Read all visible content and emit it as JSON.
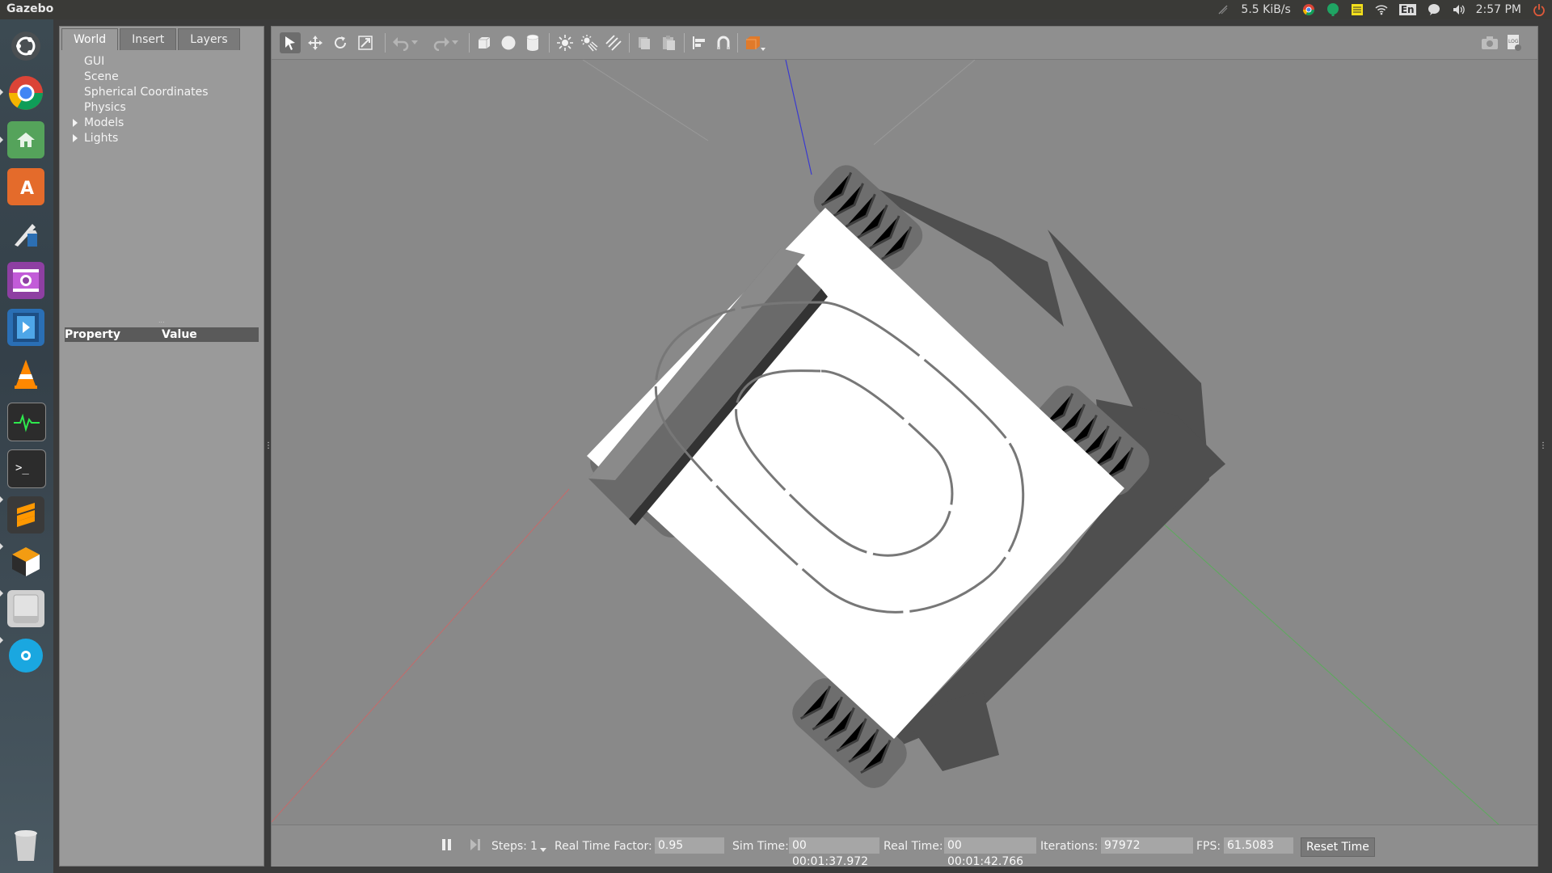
{
  "topbar": {
    "app_title": "Gazebo",
    "network_speed": "5.5 KiB/s",
    "keyboard_layout": "En",
    "time": "2:57 PM",
    "icons": [
      "wireless-icon",
      "chrome-tray-icon",
      "notification-icon",
      "sticky-notes-icon",
      "wifi-icon",
      "keyboard-icon",
      "messaging-icon",
      "volume-icon",
      "power-icon"
    ]
  },
  "launcher": {
    "items": [
      {
        "name": "ubuntu-dash-icon",
        "bg": "#4a4f52"
      },
      {
        "name": "chrome-icon",
        "bg": "#39444b"
      },
      {
        "name": "files-icon",
        "bg": "#55a35b"
      },
      {
        "name": "software-center-icon",
        "bg": "#e46b2b"
      },
      {
        "name": "editor-icon",
        "bg": "#39444b"
      },
      {
        "name": "screen-recorder-icon",
        "bg": "#8e3fa2"
      },
      {
        "name": "video-player-icon",
        "bg": "#2a6fb5"
      },
      {
        "name": "vlc-icon",
        "bg": "#39444b"
      },
      {
        "name": "system-monitor-icon",
        "bg": "#2c2c2c"
      },
      {
        "name": "terminal-icon",
        "bg": "#2c2c2c"
      },
      {
        "name": "sublime-text-icon",
        "bg": "#3a3a3a"
      },
      {
        "name": "gazebo-icon",
        "bg": "#3a3a3a"
      },
      {
        "name": "drive-icon",
        "bg": "#d0d0d0"
      },
      {
        "name": "disc-icon",
        "bg": "#1aa7e0"
      },
      {
        "name": "trash-icon",
        "bg": "#39444b"
      }
    ]
  },
  "left_panel": {
    "tabs": [
      "World",
      "Insert",
      "Layers"
    ],
    "active_tab": "World",
    "tree": [
      {
        "label": "GUI",
        "expandable": false
      },
      {
        "label": "Scene",
        "expandable": false
      },
      {
        "label": "Spherical Coordinates",
        "expandable": false
      },
      {
        "label": "Physics",
        "expandable": false
      },
      {
        "label": "Models",
        "expandable": true
      },
      {
        "label": "Lights",
        "expandable": true
      }
    ],
    "property_header": {
      "property": "Property",
      "value": "Value"
    }
  },
  "toolbar": {
    "tools": [
      "select-arrow-icon",
      "translate-icon",
      "rotate-icon",
      "scale-icon",
      "undo-icon",
      "undo-dropdown-icon",
      "redo-icon",
      "redo-dropdown-icon",
      "box-shape-icon",
      "sphere-shape-icon",
      "cylinder-shape-icon",
      "point-light-icon",
      "spot-light-icon",
      "directional-light-icon",
      "copy-icon",
      "paste-icon",
      "align-icon",
      "snap-icon",
      "view-angle-icon"
    ],
    "right_tools": [
      "screenshot-icon",
      "log-icon"
    ]
  },
  "bottom_bar": {
    "steps_label": "Steps:",
    "steps_value": "1",
    "rtf_label": "Real Time Factor:",
    "rtf_value": "0.95",
    "sim_time_label": "Sim Time:",
    "sim_time_value": "00 00:01:37.972",
    "real_time_label": "Real Time:",
    "real_time_value": "00 00:01:42.766",
    "iterations_label": "Iterations:",
    "iterations_value": "97972",
    "fps_label": "FPS:",
    "fps_value": "61.5083",
    "reset_label": "Reset Time"
  },
  "colors": {
    "scene_bg": "#898989",
    "ground_plane": "#ffffff",
    "wheel": "#6e6e6e",
    "axis_x": "#c66a6a",
    "axis_y": "#5caa5c",
    "axis_z": "#3a3ad0"
  }
}
